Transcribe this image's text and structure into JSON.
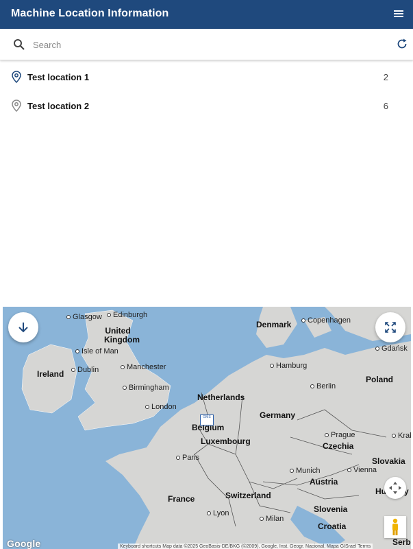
{
  "app": {
    "title": "Machine Location Information",
    "menu_icon": "hamburger-menu-icon"
  },
  "search": {
    "placeholder": "Search",
    "value": "",
    "search_icon": "search-icon",
    "refresh_icon": "refresh-icon"
  },
  "locations": [
    {
      "name": "Test location 1",
      "count": "2",
      "icon": "location-pin-icon",
      "color": "#1f497d"
    },
    {
      "name": "Test location 2",
      "count": "6",
      "icon": "location-pin-icon",
      "color": "#8a8a8a"
    }
  ],
  "map": {
    "countries": [
      "Denmark",
      "United Kingdom",
      "Ireland",
      "Netherlands",
      "Germany",
      "Poland",
      "Belgium",
      "Luxembourg",
      "Czechia",
      "Slovakia",
      "France",
      "Switzerland",
      "Austria",
      "Hungary",
      "Slovenia",
      "Croatia",
      "Serb"
    ],
    "cities": [
      "Glasgow",
      "Edinburgh",
      "Copenhagen",
      "Isle of Man",
      "Dublin",
      "Manchester",
      "Hamburg",
      "Gdańsk",
      "Birmingham",
      "Berlin",
      "London",
      "Prague",
      "Krak",
      "Paris",
      "Munich",
      "Vienna",
      "Lyon",
      "Milan"
    ],
    "google_logo": "Google",
    "attribution": "Keyboard shortcuts   Map data ©2025 GeoBasis-DE/BKG (©2009), Google, Inst. Geogr. Nacional, Mapa GISrael   Terms",
    "marker_label": "GMS",
    "collapse_icon": "arrow-down-icon",
    "fullscreen_icon": "fullscreen-icon",
    "camera_control_icon": "camera-control-icon",
    "street_view_icon": "pegman-icon",
    "colors": {
      "sea": "#8ab4d8",
      "land": "#d6d6d4",
      "header": "#1f497d"
    }
  }
}
